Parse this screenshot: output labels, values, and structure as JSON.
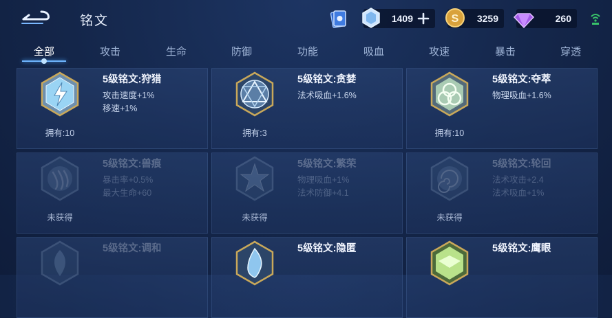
{
  "header": {
    "title": "铭文",
    "currencies": [
      {
        "name": "gem",
        "value": "1409"
      },
      {
        "name": "coin",
        "value": "3259"
      },
      {
        "name": "diamond",
        "value": "260"
      }
    ]
  },
  "tabs": [
    {
      "label": "全部",
      "active": true
    },
    {
      "label": "攻击"
    },
    {
      "label": "生命"
    },
    {
      "label": "防御"
    },
    {
      "label": "功能"
    },
    {
      "label": "吸血"
    },
    {
      "label": "攻速"
    },
    {
      "label": "暴击"
    },
    {
      "label": "穿透"
    }
  ],
  "cards": [
    {
      "name": "5级铭文:狩猎",
      "attr1": "攻击速度+1%",
      "attr2": "移速+1%",
      "owned": "拥有:10",
      "color": "#9ad4f4",
      "icon": "bolt-emblem-icon"
    },
    {
      "name": "5级铭文:贪婪",
      "attr1": "法术吸血+1.6%",
      "attr2": "",
      "owned": "拥有:3",
      "color": "#a9c9e2",
      "icon": "triangle-emblem-icon"
    },
    {
      "name": "5级铭文:夺萃",
      "attr1": "物理吸血+1.6%",
      "attr2": "",
      "owned": "拥有:10",
      "color": "#c7e0c4",
      "icon": "knot-emblem-icon"
    },
    {
      "name": "5级铭文:兽痕",
      "attr1": "暴击率+0.5%",
      "attr2": "最大生命+60",
      "owned": "未获得",
      "color": "#7f9bb8",
      "icon": "claw-emblem-icon"
    },
    {
      "name": "5级铭文:繁荣",
      "attr1": "物理吸血+1%",
      "attr2": "法术防御+4.1",
      "owned": "未获得",
      "color": "#7f9bb8",
      "icon": "star-emblem-icon"
    },
    {
      "name": "5级铭文:轮回",
      "attr1": "法术攻击+2.4",
      "attr2": "法术吸血+1%",
      "owned": "未获得",
      "color": "#7f9bb8",
      "icon": "swirl-emblem-icon"
    },
    {
      "name": "5级铭文:调和",
      "attr1": "",
      "attr2": "",
      "owned": "",
      "color": "#7f9bb8",
      "icon": "leaf-emblem-icon"
    },
    {
      "name": "5级铭文:隐匿",
      "attr1": "",
      "attr2": "",
      "owned": "",
      "color": "#8fc6ee",
      "icon": "flame-emblem-icon"
    },
    {
      "name": "5级铭文:鹰眼",
      "attr1": "",
      "attr2": "",
      "owned": "",
      "color": "#b9e28a",
      "icon": "eagle-emblem-icon"
    }
  ]
}
